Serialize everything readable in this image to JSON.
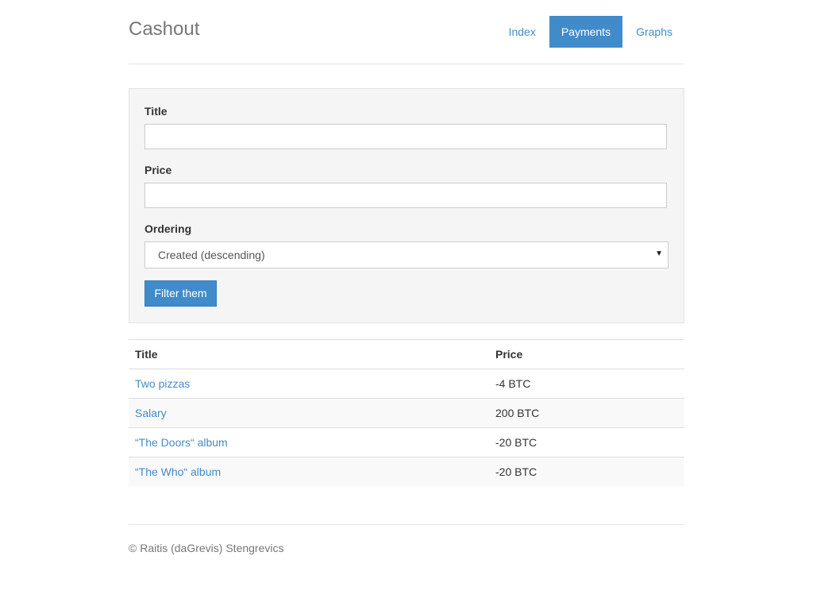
{
  "header": {
    "brand": "Cashout",
    "nav": [
      {
        "label": "Index",
        "active": false
      },
      {
        "label": "Payments",
        "active": true
      },
      {
        "label": "Graphs",
        "active": false
      }
    ]
  },
  "filter": {
    "title_label": "Title",
    "title_value": "",
    "price_label": "Price",
    "price_value": "",
    "ordering_label": "Ordering",
    "ordering_selected": "Created (descending)",
    "submit_label": "Filter them"
  },
  "table": {
    "headers": [
      "Title",
      "Price"
    ],
    "rows": [
      {
        "title": "Two pizzas",
        "price": "-4 BTC"
      },
      {
        "title": "Salary",
        "price": "200 BTC"
      },
      {
        "title": "“The Doors“ album",
        "price": "-20 BTC"
      },
      {
        "title": "“The Who“ album",
        "price": "-20 BTC"
      }
    ]
  },
  "footer": {
    "text": "© Raitis (daGrevis) Stengrevics"
  },
  "colors": {
    "accent": "#428bca",
    "panel_bg": "#f5f5f5",
    "stripe_bg": "#f9f9f9"
  }
}
